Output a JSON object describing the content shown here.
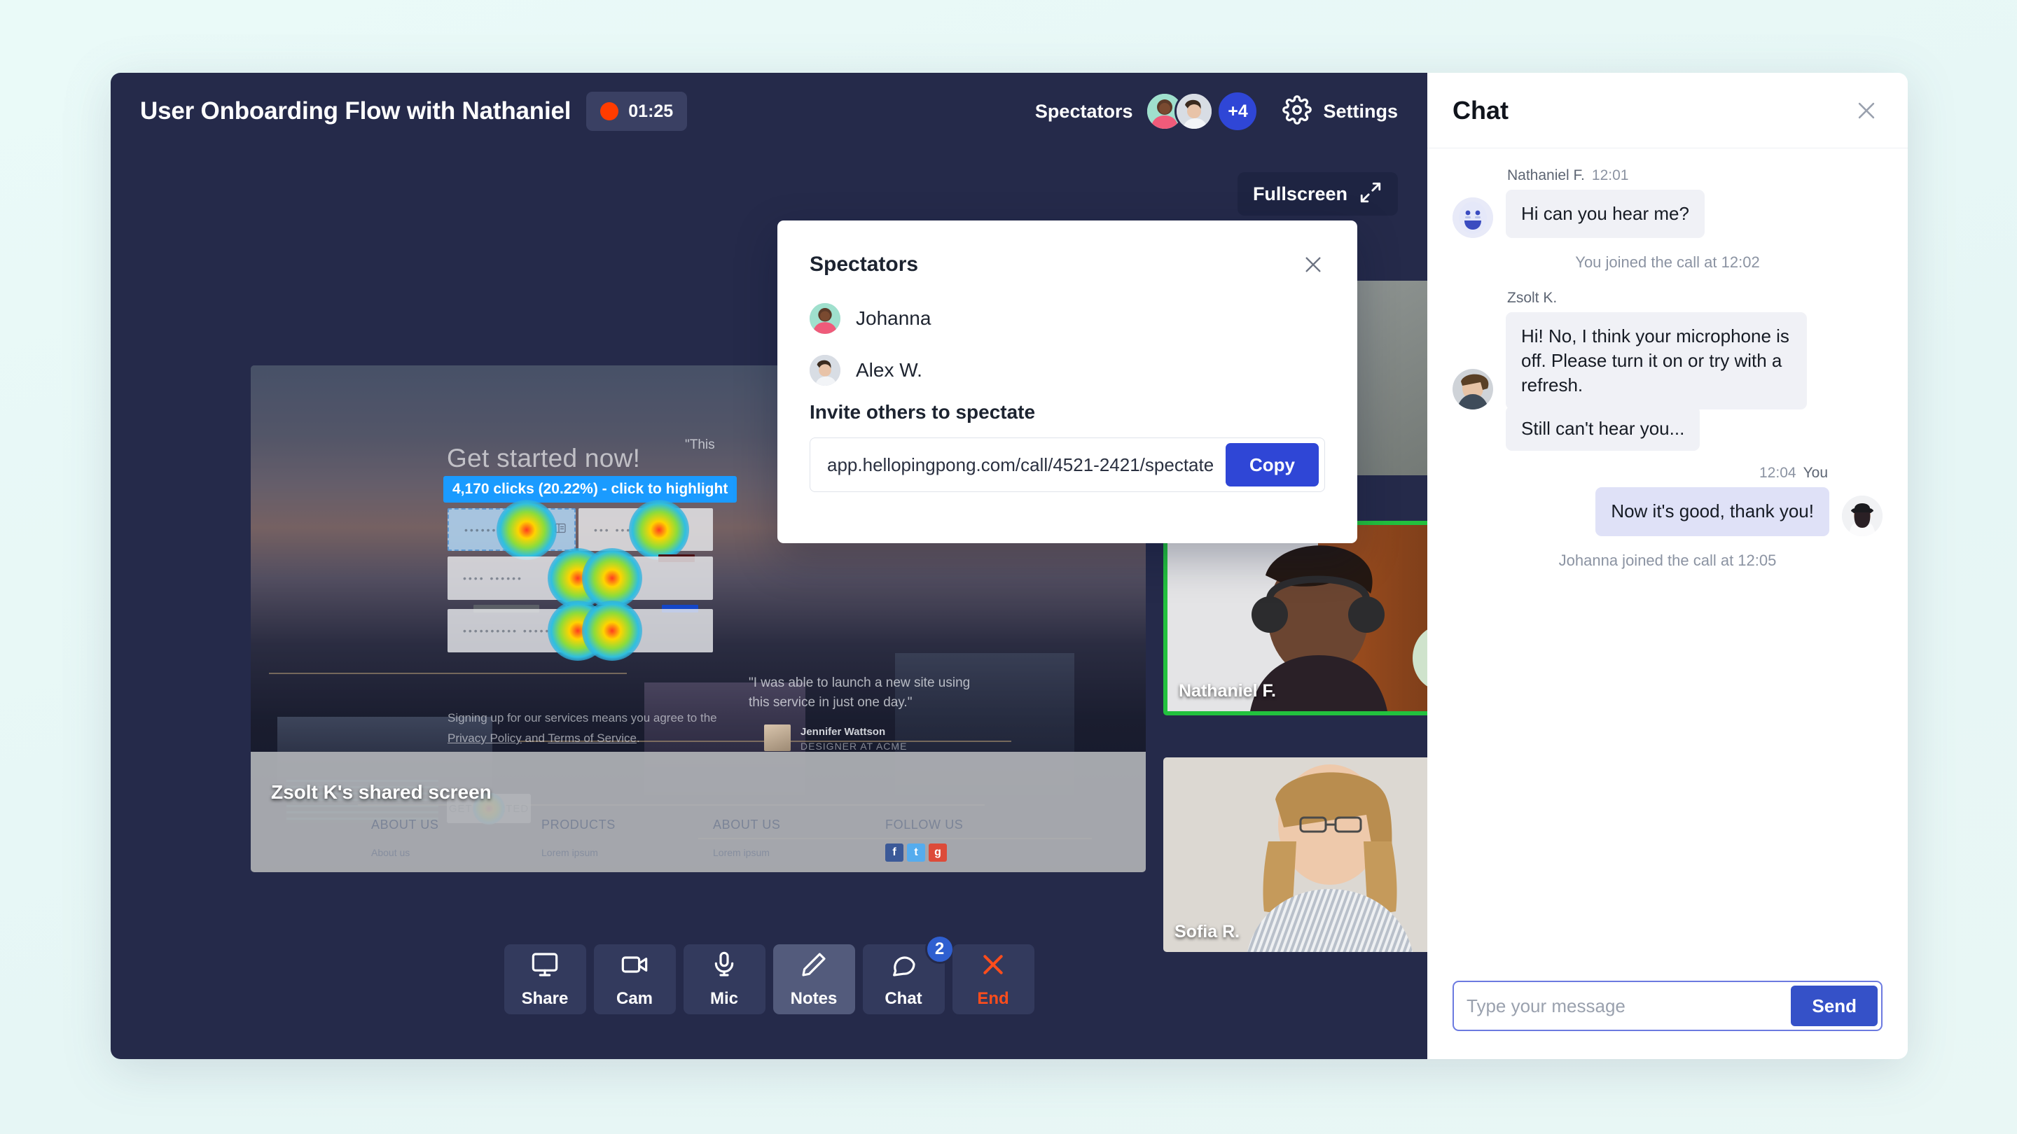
{
  "header": {
    "meeting_title": "User Onboarding Flow with Nathaniel",
    "recording_time": "01:25",
    "spectators_label": "Spectators",
    "spectators_overflow": "+4",
    "settings_label": "Settings",
    "fullscreen_label": "Fullscreen"
  },
  "shared_screen": {
    "label": "Zsolt K's shared screen",
    "hero_heading": "Get started now!",
    "click_badge": "4,170 clicks (20.22%) - click to highlight",
    "legal_line1": "Signing up for our services means you agree to the",
    "legal_privacy": "Privacy Policy",
    "legal_and": "and",
    "legal_terms": "Terms of Service",
    "legal_dot": ".",
    "cta_label": "GET STARTED",
    "quote_partial": "\"This",
    "quote_text": "\"I was able to launch a new site using this service in just one day.\"",
    "quote_name": "Jennifer Wattson",
    "quote_role": "DESIGNER AT ACME",
    "footer_columns": [
      {
        "heading": "ABOUT US",
        "item": "About us"
      },
      {
        "heading": "PRODUCTS",
        "item": "Lorem ipsum"
      },
      {
        "heading": "ABOUT US",
        "item": "Lorem ipsum"
      },
      {
        "heading": "FOLLOW US",
        "item": ""
      }
    ],
    "social": [
      "f",
      "t",
      "g"
    ],
    "form_placeholders": [
      "•••••• •",
      "••• •••",
      "•••• ••••••",
      "•••••••••• •••••"
    ]
  },
  "tiles": [
    {
      "name": ""
    },
    {
      "name": "Nathaniel F."
    },
    {
      "name": "Sofia R."
    }
  ],
  "controls": [
    {
      "label": "Share",
      "icon": "monitor-icon",
      "active": false,
      "badge": ""
    },
    {
      "label": "Cam",
      "icon": "camera-icon",
      "active": false,
      "badge": ""
    },
    {
      "label": "Mic",
      "icon": "mic-icon",
      "active": false,
      "badge": ""
    },
    {
      "label": "Notes",
      "icon": "pencil-icon",
      "active": true,
      "badge": ""
    },
    {
      "label": "Chat",
      "icon": "bubble-icon",
      "active": false,
      "badge": "2"
    },
    {
      "label": "End",
      "icon": "x-icon",
      "active": false,
      "badge": ""
    }
  ],
  "modal": {
    "title": "Spectators",
    "people": [
      {
        "name": "Johanna"
      },
      {
        "name": "Alex W."
      }
    ],
    "invite_label": "Invite others to spectate",
    "invite_url": "app.hellopingpong.com/call/4521-2421/spectate",
    "copy_label": "Copy"
  },
  "chat": {
    "title": "Chat",
    "messages": [
      {
        "kind": "msg",
        "author": "Nathaniel F.",
        "time": "12:01",
        "text": "Hi can you hear me?",
        "side": "left"
      },
      {
        "kind": "system",
        "text": "You joined the call at 12:02"
      },
      {
        "kind": "msg",
        "author": "Zsolt K.",
        "time": "",
        "text": "Hi! No, I think your microphone is off. Please turn it on or try with a refresh.",
        "side": "left"
      },
      {
        "kind": "sub",
        "text": "Still can't hear you...",
        "side": "left"
      },
      {
        "kind": "msg",
        "author": "You",
        "time": "12:04",
        "text": "Now it's good, thank you!",
        "side": "right"
      },
      {
        "kind": "system",
        "text": "Johanna joined the call at 12:05"
      }
    ],
    "input_placeholder": "Type your message",
    "input_value": "",
    "send_label": "Send"
  },
  "colors": {
    "panel_dark": "#252a4a",
    "accent_blue": "#2f46d6",
    "send_blue": "#3551c8",
    "badge_blue": "#2f5fd0",
    "record_red": "#ff3c00",
    "end_orange": "#ff4d1c",
    "active_green": "#22c13e",
    "highlight_blue": "#1a9bff",
    "page_bg": "#e9f7f6"
  }
}
